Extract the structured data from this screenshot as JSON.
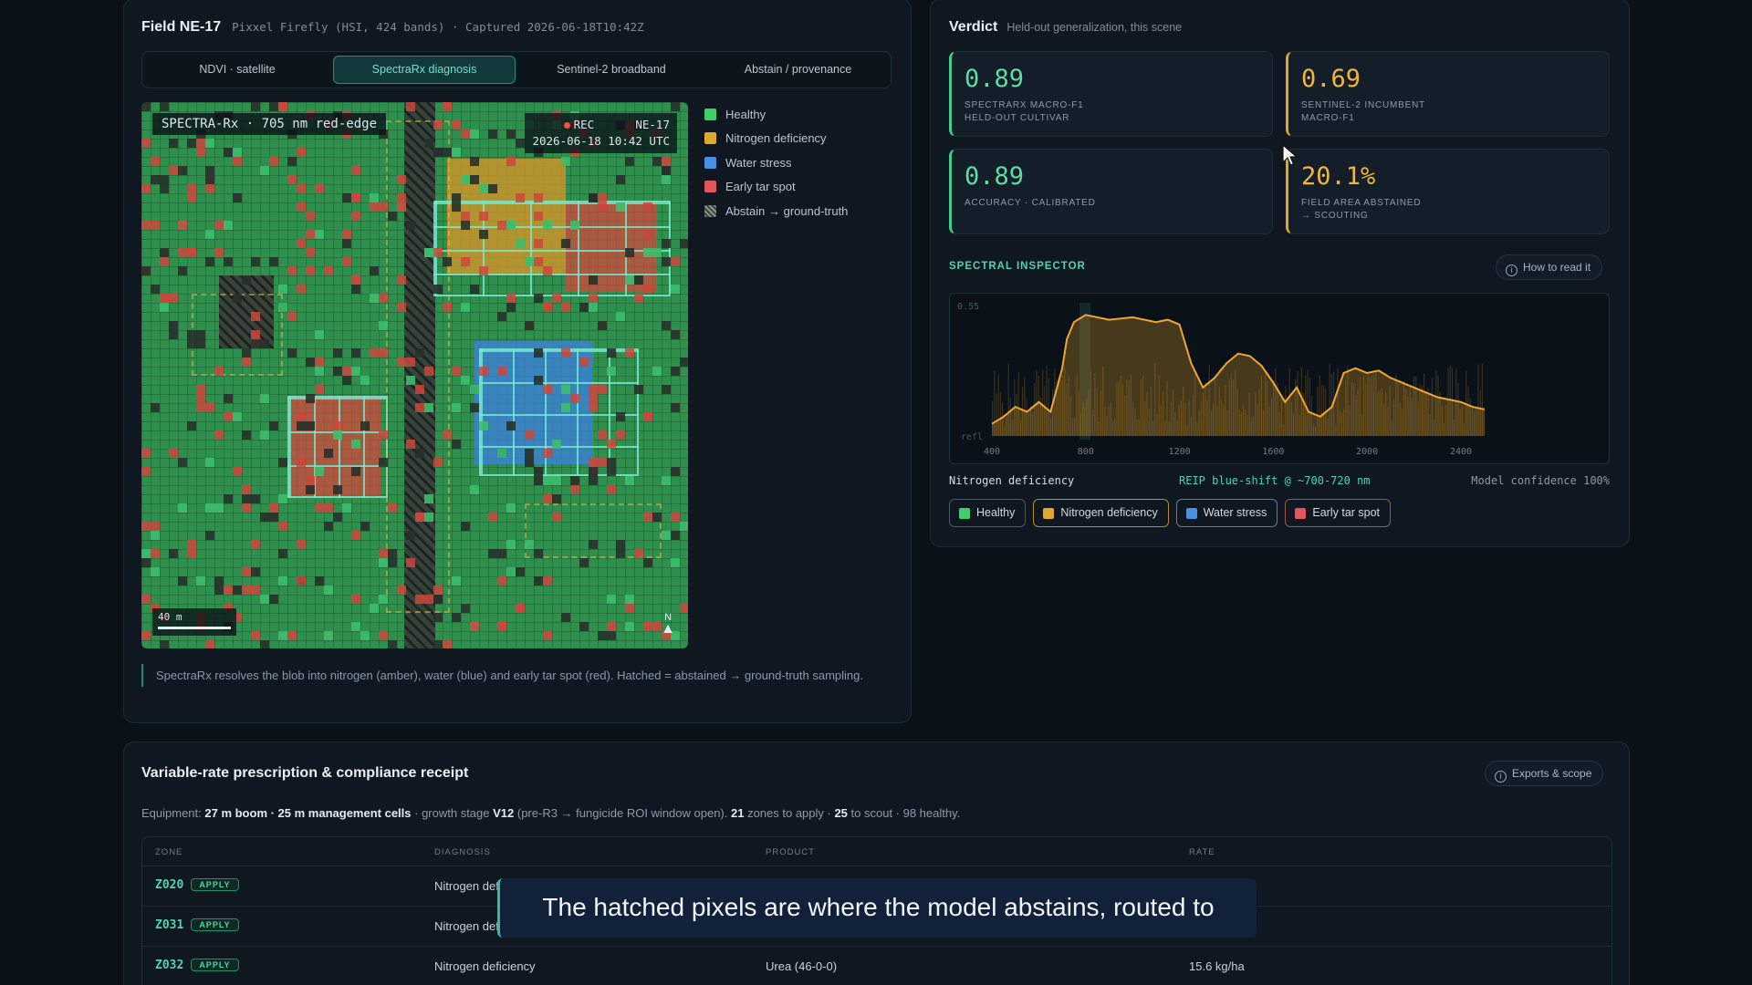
{
  "field": {
    "title": "Field NE-17",
    "subtitle": "Pixxel Firefly (HSI, 424 bands) · Captured 2026-06-18T10:42Z",
    "tabs": [
      "NDVI · satellite",
      "SpectraRx diagnosis",
      "Sentinel-2 broadband",
      "Abstain / provenance"
    ],
    "active_tab": "SpectraRx diagnosis",
    "map_label": "SPECTRA-Rx · 705 nm red-edge",
    "rec_label": "REC",
    "field_code": "NE-17",
    "timestamp": "2026-06-18 10:42 UTC",
    "scale_label": "40 m",
    "north_label": "N",
    "legend": [
      {
        "label": "Healthy",
        "color": "#3ecf6a"
      },
      {
        "label": "Nitrogen deficiency",
        "color": "#e0a62e"
      },
      {
        "label": "Water stress",
        "color": "#4a90e2"
      },
      {
        "label": "Early tar spot",
        "color": "#e2555a"
      },
      {
        "label": "Abstain → ground-truth",
        "color": "hatched"
      }
    ],
    "caption": "SpectraRx resolves the blob into nitrogen (amber), water (blue) and early tar spot (red). Hatched = abstained → ground-truth sampling."
  },
  "verdict": {
    "title": "Verdict",
    "subtitle": "Held-out generalization, this scene",
    "metrics": [
      {
        "value": "0.89",
        "label_1": "SPECTRARX MACRO-F1",
        "label_2": "HELD-OUT CULTIVAR"
      },
      {
        "value": "0.69",
        "label_1": "SENTINEL-2 INCUMBENT",
        "label_2": "MACRO-F1"
      },
      {
        "value": "0.89",
        "label_1": "ACCURACY · CALIBRATED",
        "label_2": ""
      },
      {
        "value": "20.1%",
        "label_1": "FIELD AREA ABSTAINED",
        "label_2": "→ SCOUTING"
      }
    ],
    "inspector_title": "SPECTRAL INSPECTOR",
    "how_to_read": "How to read it",
    "diagnosis": "Nitrogen deficiency",
    "shift_note": "REIP blue-shift @ ~700-720 nm",
    "confidence": "Model confidence 100%",
    "chips": [
      "Healthy",
      "Nitrogen deficiency",
      "Water stress",
      "Early tar spot"
    ]
  },
  "chart_data": {
    "type": "line",
    "ylabel": "refl",
    "y_tick": "0.55",
    "x_ticks": [
      400,
      800,
      1200,
      1600,
      2000,
      2400
    ],
    "x": [
      400,
      450,
      500,
      550,
      600,
      650,
      700,
      720,
      750,
      800,
      900,
      1000,
      1100,
      1150,
      1200,
      1250,
      1300,
      1350,
      1400,
      1450,
      1500,
      1550,
      1600,
      1650,
      1700,
      1750,
      1800,
      1850,
      1900,
      1950,
      2000,
      2050,
      2100,
      2200,
      2300,
      2400,
      2450,
      2500
    ],
    "values": [
      0.05,
      0.08,
      0.12,
      0.1,
      0.14,
      0.1,
      0.28,
      0.4,
      0.47,
      0.5,
      0.48,
      0.49,
      0.47,
      0.48,
      0.46,
      0.3,
      0.2,
      0.24,
      0.3,
      0.34,
      0.33,
      0.29,
      0.22,
      0.14,
      0.2,
      0.1,
      0.08,
      0.12,
      0.26,
      0.28,
      0.26,
      0.27,
      0.24,
      0.2,
      0.16,
      0.14,
      0.12,
      0.11
    ]
  },
  "rx": {
    "title": "Variable-rate prescription & compliance receipt",
    "exports_label": "Exports & scope",
    "equip_prefix": "Equipment: ",
    "equip_bold": "27 m boom · 25 m management cells",
    "equip_mid": " · growth stage ",
    "stage": "V12",
    "stage_note": " (pre-R3 → fungicide ROI window open). ",
    "zones_apply": "21",
    "zones_apply_text": " zones to apply · ",
    "zones_scout": "25",
    "zones_scout_text": " to scout · 98 healthy.",
    "headers": [
      "ZONE",
      "DIAGNOSIS",
      "PRODUCT",
      "RATE"
    ],
    "rows": [
      {
        "zone": "Z020",
        "badge": "APPLY",
        "diagnosis": "Nitrogen deficiency",
        "product": "",
        "rate": ""
      },
      {
        "zone": "Z031",
        "badge": "APPLY",
        "diagnosis": "Nitrogen deficiency",
        "product": "",
        "rate": ""
      },
      {
        "zone": "Z032",
        "badge": "APPLY",
        "diagnosis": "Nitrogen deficiency",
        "product": "Urea (46-0-0)",
        "rate": "15.6 kg/ha"
      }
    ]
  },
  "subtitle_overlay": "The hatched pixels are where the model abstains, routed to"
}
